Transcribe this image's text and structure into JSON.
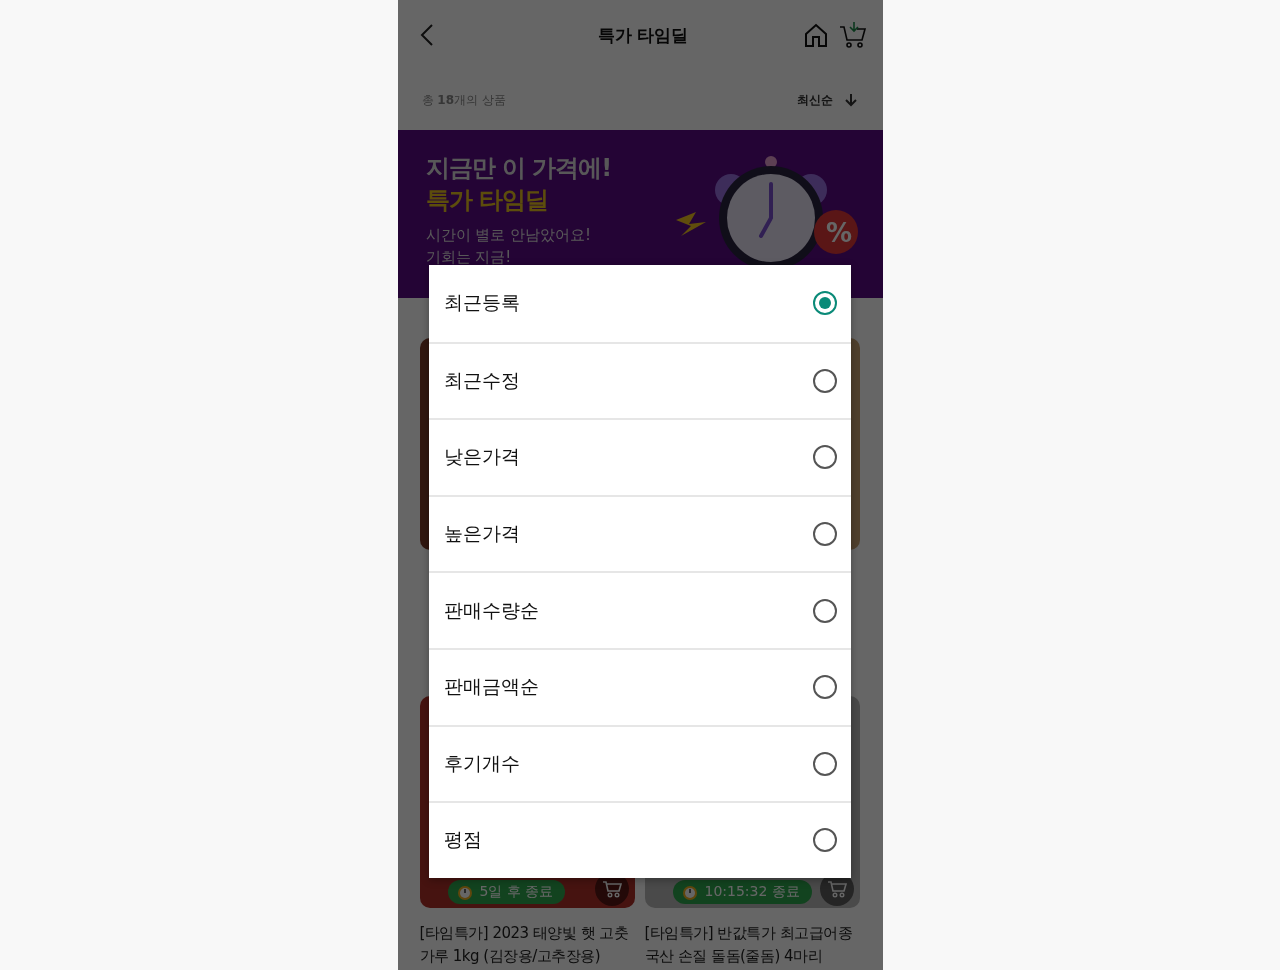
{
  "header": {
    "title": "특가 타임딜"
  },
  "summary": {
    "count_text": "총 **18**개의 상품",
    "sort_label": "최신순"
  },
  "banner": {
    "headline": "지금만 이 가격에!",
    "title": "특가 타임딜",
    "subtitle": "시간이 별로 안남았어요!",
    "subtitle_2": "기회는 지금!",
    "sale_tag": "%"
  },
  "products": [
    {
      "badge": "5일 후 종료",
      "title": "[타임특가] 2023 태양빛 햇 고춧가루 1kg (김장용/고추장용)"
    },
    {
      "badge": "10:15:32 종료",
      "title": "[타임특가] 반값특가 최고급어종 국산 손질 돌돔(줄돔) 4마리"
    }
  ],
  "sort_dialog": {
    "options": [
      {
        "label": "최근등록",
        "selected": true
      },
      {
        "label": "최근수정",
        "selected": false
      },
      {
        "label": "낮은가격",
        "selected": false
      },
      {
        "label": "높은가격",
        "selected": false
      },
      {
        "label": "판매수량순",
        "selected": false
      },
      {
        "label": "판매금액순",
        "selected": false
      },
      {
        "label": "후기개수",
        "selected": false
      },
      {
        "label": "평점",
        "selected": false
      }
    ]
  }
}
